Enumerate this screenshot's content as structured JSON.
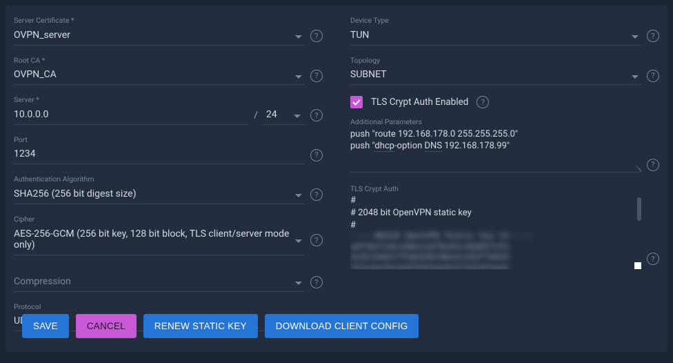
{
  "left": {
    "server_cert": {
      "label": "Server Certificate *",
      "value": "OVPN_server"
    },
    "root_ca": {
      "label": "Root CA *",
      "value": "OVPN_CA"
    },
    "server": {
      "label": "Server *",
      "ip": "10.0.0.0",
      "prefix": "24"
    },
    "port": {
      "label": "Port",
      "value": "1234"
    },
    "auth_algo": {
      "label": "Authentication Algorithm",
      "value": "SHA256 (256 bit digest size)"
    },
    "cipher": {
      "label": "Cipher",
      "value": "AES-256-GCM (256 bit key, 128 bit block, TLS client/server mode only)"
    },
    "compression": {
      "label": "Compression",
      "value": ""
    },
    "protocol": {
      "label": "Protocol",
      "value": "UDP"
    }
  },
  "right": {
    "device_type": {
      "label": "Device Type",
      "value": "TUN"
    },
    "topology": {
      "label": "Topology",
      "value": "SUBNET"
    },
    "tls_enabled_label": "TLS Crypt Auth Enabled",
    "additional_params": {
      "label": "Additional Parameters",
      "line1_a": "push \"route 192.168.178.0 255.255.255.0\"",
      "line2_a": "push \"",
      "line2_b": "dhcp",
      "line2_c": "-option ",
      "line2_d": "DNS",
      "line2_e": " 192.168.178.99\""
    },
    "tls_crypt": {
      "label": "TLS Crypt Auth",
      "l1": "#",
      "l2": "# 2048 bit OpenVPN static key",
      "l3": "#"
    }
  },
  "buttons": {
    "save": "SAVE",
    "cancel": "CANCEL",
    "renew": "RENEW STATIC KEY",
    "download": "DOWNLOAD CLIENT CONFIG"
  }
}
